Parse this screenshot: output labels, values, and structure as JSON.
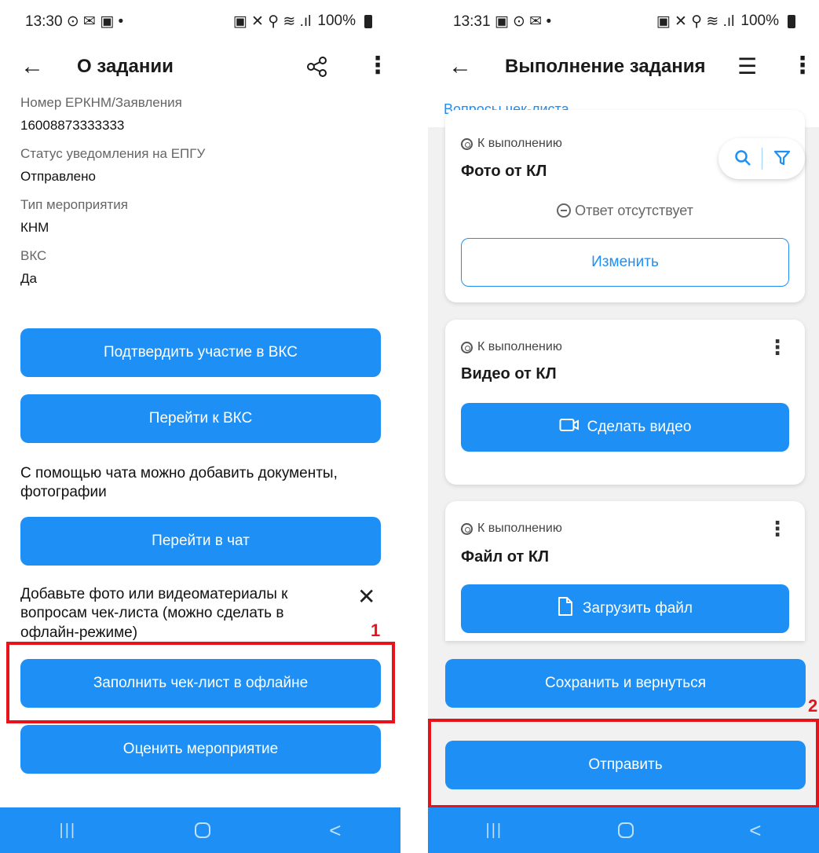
{
  "left": {
    "status": {
      "time": "13:30",
      "left_icons": "⊙ ✉ ▣ •",
      "right_icons": "▣ ✕ ⚲ ≋ .ıl",
      "battery": "100%"
    },
    "appbar": {
      "title": "О задании",
      "back_icon": "←",
      "share_icon": "≺",
      "menu_icon": "⋮"
    },
    "fields": [
      {
        "label": "Номер ЕРКНМ/Заявления",
        "value": "16008873333333"
      },
      {
        "label": "Статус уведомления на ЕПГУ",
        "value": "Отправлено"
      },
      {
        "label": "Тип мероприятия",
        "value": "КНМ"
      },
      {
        "label": "ВКС",
        "value": "Да"
      }
    ],
    "buttons": {
      "confirm_vks": "Подтвердить участие в ВКС",
      "go_vks": "Перейти к ВКС",
      "go_chat": "Перейти в чат",
      "fill_offline": "Заполнить чек-лист в офлайне",
      "rate_event": "Оценить мероприятие"
    },
    "chat_hint": "С помощью чата можно добавить документы, фотографии",
    "media_hint": "Добавьте фото или видеоматериалы к вопросам чек-листа (можно сделать в офлайн-режиме)",
    "close_icon": "✕",
    "marker": "1"
  },
  "right": {
    "status": {
      "time": "13:31",
      "left_icons": "▣ ⊙ ✉ •",
      "right_icons": "▣ ✕ ⚲ ≋ .ıl",
      "battery": "100%"
    },
    "appbar": {
      "title": "Выполнение задания",
      "back_icon": "←",
      "list_icon": "☰",
      "menu_icon": "⋮"
    },
    "section_link": "Вопросы чек-листа",
    "search_icon": "⚲",
    "filter_icon": "▽",
    "cards": [
      {
        "status": "К выполнению",
        "title": "Фото от КЛ",
        "no_answer": "Ответ отсутствует",
        "action": "Изменить"
      },
      {
        "status": "К выполнению",
        "title": "Видео от КЛ",
        "action": "Сделать видео",
        "action_icon": "▭"
      },
      {
        "status": "К выполнению",
        "title": "Файл от КЛ",
        "action": "Загрузить файл",
        "action_icon": "🗋"
      }
    ],
    "buttons": {
      "save_return": "Сохранить и вернуться",
      "send": "Отправить"
    },
    "marker": "2"
  },
  "nav": {
    "recent": "|||",
    "home": "",
    "back": "<"
  }
}
